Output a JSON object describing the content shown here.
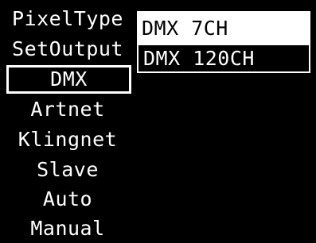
{
  "menu": {
    "items": [
      {
        "label": "PixelType"
      },
      {
        "label": "SetOutput"
      },
      {
        "label": "DMX"
      },
      {
        "label": "Artnet"
      },
      {
        "label": "Klingnet"
      },
      {
        "label": "Slave"
      },
      {
        "label": "Auto"
      },
      {
        "label": "Manual"
      }
    ],
    "selected": "DMX"
  },
  "popup": {
    "options": [
      {
        "label": "DMX 7CH"
      },
      {
        "label": "DMX 120CH"
      }
    ],
    "highlighted": "DMX 120CH"
  },
  "colors": {
    "background": "#000000",
    "foreground": "#ffffff"
  }
}
